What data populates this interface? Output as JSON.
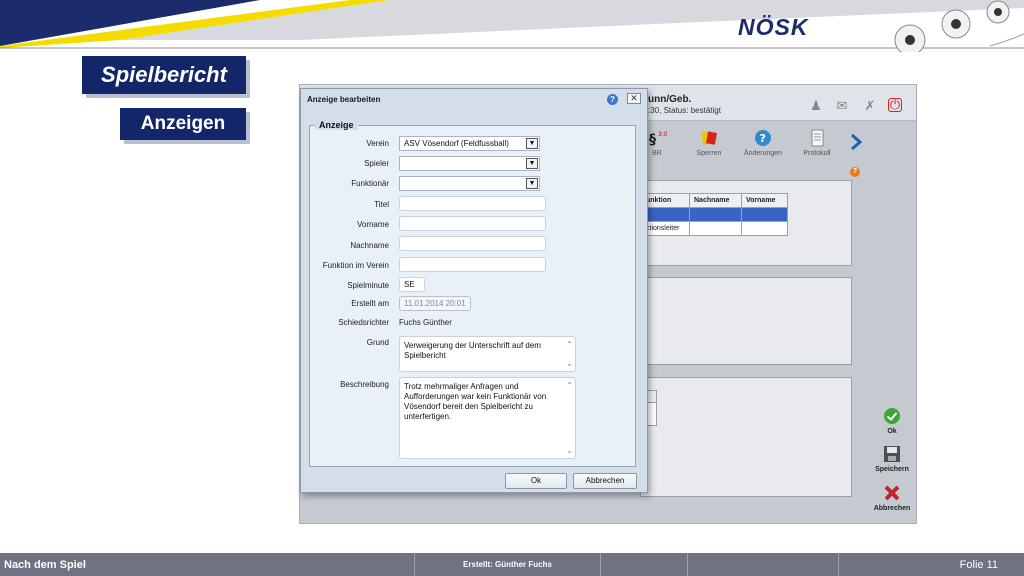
{
  "slide": {
    "brand": "NÖSK",
    "title": "Spielbericht",
    "subtitle": "Anzeigen"
  },
  "app": {
    "header_title": "unn/Geb.",
    "header_subtitle": ":30, Status: bestätigt",
    "toolbar": [
      {
        "label": "BR",
        "icon": "paragraph-icon"
      },
      {
        "label": "Sperren",
        "icon": "card-icon"
      },
      {
        "label": "Änderungen",
        "icon": "help-icon"
      },
      {
        "label": "Protokoll",
        "icon": "document-icon"
      }
    ],
    "table": {
      "headers": [
        "unktion",
        "Nachname",
        "Vorname"
      ],
      "rows": [
        [
          "",
          "",
          ""
        ],
        [
          "ctionsleiter",
          "",
          ""
        ]
      ]
    },
    "side_buttons": {
      "ok": "Ok",
      "save": "Speichern",
      "cancel": "Abbrechen"
    },
    "colors": {
      "accent": "#3b63c4",
      "ok": "#3aa635",
      "cancel": "#c0262c"
    }
  },
  "dialog": {
    "title": "Anzeige bearbeiten",
    "legend": "Anzeige",
    "fields": {
      "verein": {
        "label": "Verein",
        "value": "ASV Vösendorf (Feldfussball)"
      },
      "spieler": {
        "label": "Spieler",
        "value": ""
      },
      "funktionaer": {
        "label": "Funktionär",
        "value": ""
      },
      "titel": {
        "label": "Titel",
        "value": ""
      },
      "vorname": {
        "label": "Vorname",
        "value": ""
      },
      "nachname": {
        "label": "Nachname",
        "value": ""
      },
      "funktion": {
        "label": "Funktion im Verein",
        "value": ""
      },
      "spielminute": {
        "label": "Spielminute",
        "value": "SE"
      },
      "erstellt": {
        "label": "Erstellt am",
        "value": "11.01.2014 20:01"
      },
      "schiedsrichter": {
        "label": "Schiedsrichter",
        "value": "Fuchs Günther"
      },
      "grund": {
        "label": "Grund",
        "value": "Verweigerung der Unterschrift auf dem Spielbericht"
      },
      "beschreibung": {
        "label": "Beschreibung",
        "value": "Trotz mehrmaliger Anfragen und Aufforderungen war kein Funktionär von Vösendorf bereit den Spielbericht zu unterfertigen."
      }
    },
    "ok_label": "Ok",
    "cancel_label": "Abbrechen"
  },
  "footer": {
    "left": "Nach dem Spiel",
    "center": "Erstellt: Günther Fuchs",
    "right": "Folie  11"
  }
}
